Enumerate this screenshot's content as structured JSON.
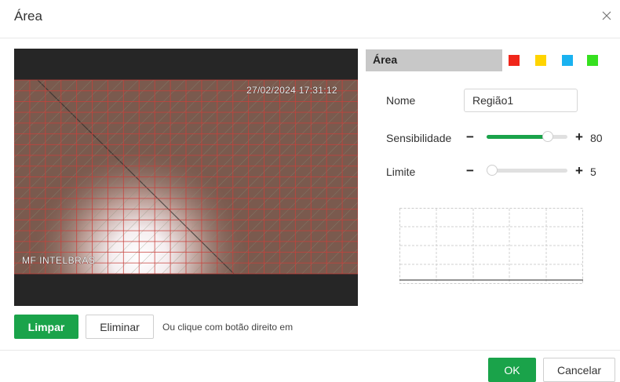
{
  "dialog": {
    "title": "Área"
  },
  "video": {
    "timestamp": "27/02/2024 17:31:12",
    "osd_label": "MF INTELBRAS"
  },
  "panel": {
    "header_label": "Área",
    "colors": [
      "#f0261a",
      "#ffd400",
      "#1ab2f0",
      "#36e01f"
    ],
    "name_label": "Nome",
    "name_value": "Região1",
    "sensitivity_label": "Sensibilidade",
    "sensitivity_value": "80",
    "sensitivity_level": 0.8,
    "limit_label": "Limite",
    "limit_value": "5",
    "limit_level": 0.0,
    "minus": "−",
    "plus": "+"
  },
  "buttons": {
    "clear": "Limpar",
    "delete": "Eliminar",
    "hint": "Ou clique com botão direito em",
    "ok": "OK",
    "cancel": "Cancelar"
  }
}
